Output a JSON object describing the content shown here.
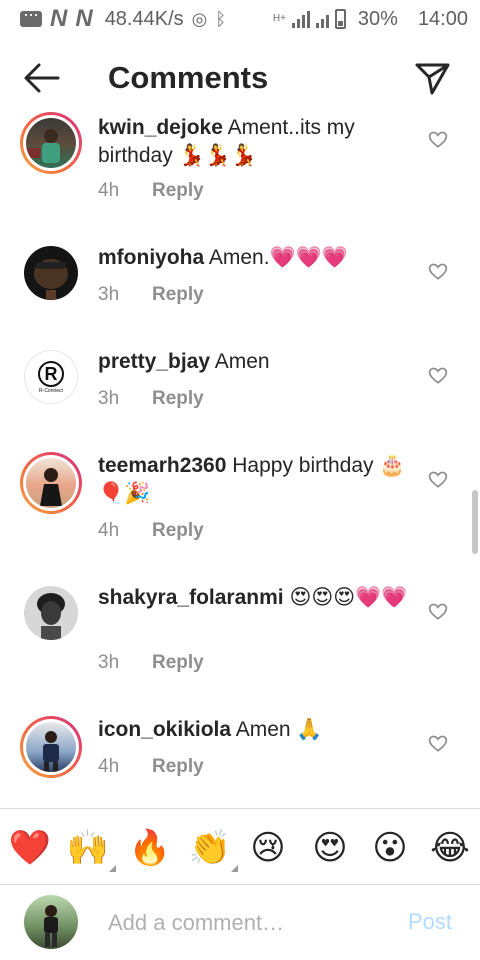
{
  "status_bar": {
    "speed": "48.44K/s",
    "network_label": "H+",
    "battery": "30%",
    "time": "14:00"
  },
  "header": {
    "title": "Comments",
    "back_icon": "arrow-left-icon",
    "send_icon": "paper-plane-icon"
  },
  "comments": [
    {
      "username": "kwin_dejoke",
      "text": "Ament..its my birthday 💃💃💃",
      "time": "4h",
      "reply_label": "Reply",
      "story_ring": true
    },
    {
      "username": "mfoniyoha",
      "text": "Amen.💗💗💗",
      "time": "3h",
      "reply_label": "Reply",
      "story_ring": false
    },
    {
      "username": "pretty_bjay",
      "text": "Amen",
      "time": "3h",
      "reply_label": "Reply",
      "story_ring": false,
      "avatar_logo_letter": "R",
      "avatar_logo_name": "R-Connect"
    },
    {
      "username": "teemarh2360",
      "text": "Happy birthday 🎂🎈🎉",
      "time": "4h",
      "reply_label": "Reply",
      "story_ring": true
    },
    {
      "username": "shakyra_folaranmi",
      "text": "😍😍😍💗💗",
      "time": "3h",
      "reply_label": "Reply",
      "story_ring": false
    },
    {
      "username": "icon_okikiola",
      "text": "Amen 🙏",
      "time": "4h",
      "reply_label": "Reply",
      "story_ring": true
    }
  ],
  "emoji_bar": [
    "❤️",
    "🙌",
    "🔥",
    "👏",
    "😢",
    "😍",
    "😮",
    "😂"
  ],
  "compose": {
    "placeholder": "Add a comment…",
    "post_label": "Post"
  },
  "colors": {
    "text": "#262626",
    "secondary": "#8e8e8e",
    "post_disabled": "#b3dbff",
    "story_ring_start": "#f9a743",
    "story_ring_end": "#d92d7f",
    "heart_emoji": "#e2476b"
  }
}
